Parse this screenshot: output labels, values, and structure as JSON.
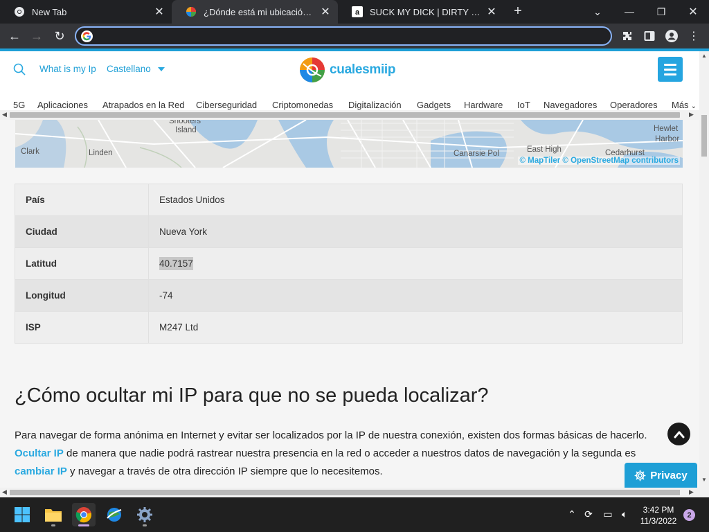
{
  "browser": {
    "tabs": [
      {
        "title": "New Tab",
        "icon": "chrome-icon"
      },
      {
        "title": "¿Dónde está mi ubicación IP? (Ge",
        "icon": "cualesmiip-favicon"
      },
      {
        "title": "SUCK MY DICK | DIRTY NOTEBOOK",
        "icon": "amazon-icon"
      }
    ],
    "address_value": "",
    "new_tab": "+"
  },
  "site": {
    "nav_links": [
      "What is my Ip",
      "Castellano"
    ],
    "logo_text": "cualesmiip",
    "categories": [
      "5G",
      "Aplicaciones",
      "Atrapados en la Red",
      "Ciberseguridad",
      "Criptomonedas",
      "Digitalización",
      "Gadgets",
      "Hardware",
      "IoT",
      "Navegadores",
      "Operadores",
      "Más"
    ]
  },
  "map": {
    "labels": [
      "Shooters",
      "Island",
      "Clark",
      "Linden",
      "Canarsie Pol",
      "East High",
      "Cedarhurst",
      "Hewlet",
      "Harbor"
    ],
    "attribution": "© MapTiler © OpenStreetMap contributors"
  },
  "table": [
    {
      "key": "País",
      "value": "Estados Unidos"
    },
    {
      "key": "Ciudad",
      "value": "Nueva York"
    },
    {
      "key": "Latitud",
      "value": "40.7157"
    },
    {
      "key": "Longitud",
      "value": "-74"
    },
    {
      "key": "ISP",
      "value": "M247 Ltd"
    }
  ],
  "article": {
    "heading": "¿Cómo ocultar mi IP para que no se pueda localizar?",
    "p_text1": "Para navegar de forma anónima en Internet y evitar ser localizados por la IP de nuestra conexión, existen dos formas básicas de hacerlo. ",
    "link1": "Ocultar IP",
    "p_text2": " de manera que nadie podrá rastrear nuestra presencia en la red o acceder a nuestros datos de navegación y la segunda es ",
    "link2": "cambiar IP",
    "p_text3": " y navegar a través de otra dirección IP siempre que lo necesitemos."
  },
  "privacy_label": "Privacy",
  "taskbar": {
    "time": "3:42 PM",
    "date": "11/3/2022",
    "notifications": "2"
  },
  "colors": {
    "accent": "#1e9fd6",
    "link": "#2aa9e0"
  }
}
